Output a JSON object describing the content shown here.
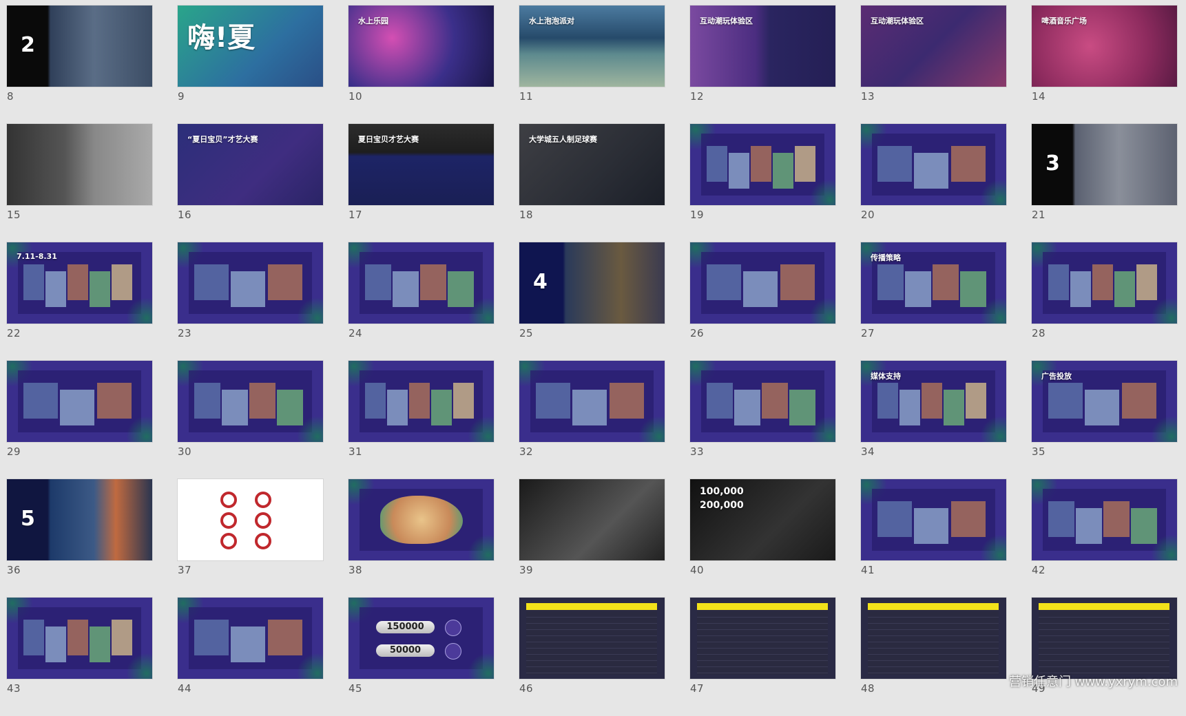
{
  "slides": [
    {
      "num": "8",
      "big": "2",
      "title": "",
      "bg": "linear-gradient(90deg,#0a0a0a 0%,#0a0a0a 28%,#30405a 30%,#5a6d86 60%,#3c4d65 100%)",
      "style": "section"
    },
    {
      "num": "9",
      "big": "嗨!夏",
      "title": "",
      "bg": "linear-gradient(135deg,#2aa58a,#2d6fa0 60%,#2a4f86)",
      "style": "haixia"
    },
    {
      "num": "10",
      "big": "",
      "title": "水上乐园",
      "bg": "radial-gradient(circle at 30% 40%,#d44fb3,#3b2f8a 55%,#1b1748)",
      "style": "party"
    },
    {
      "num": "11",
      "big": "",
      "title": "水上泡泡派对",
      "bg": "linear-gradient(180deg,#4c7ba0 0%,#264a6a 40%,#5d8a8e 60%,#9fb59f 100%)",
      "style": "photo"
    },
    {
      "num": "12",
      "big": "",
      "title": "互动潮玩体验区",
      "bg": "linear-gradient(90deg,#7b4aa0 0%,#4b2d80 45%,#2a2560 55%,#241f55 100%)",
      "style": "photo"
    },
    {
      "num": "13",
      "big": "",
      "title": "互动潮玩体验区",
      "bg": "linear-gradient(135deg,#5b2c73,#3c2a70 50%,#8a3a6a)",
      "style": "photo"
    },
    {
      "num": "14",
      "big": "",
      "title": "啤酒音乐广场",
      "bg": "radial-gradient(circle at 40% 50%,#c94c83,#8d2b5e 60%,#5a1b44)",
      "style": "party"
    },
    {
      "num": "15",
      "big": "",
      "title": "",
      "bg": "linear-gradient(90deg,#333 0%,#555 40%,#888 60%,#aaa 100%)",
      "style": "photo"
    },
    {
      "num": "16",
      "big": "",
      "title": "“夏日宝贝”才艺大赛",
      "bg": "linear-gradient(135deg,#2c2f7a,#3f2d80 60%,#2a2466)",
      "style": "talent"
    },
    {
      "num": "17",
      "big": "",
      "title": "夏日宝贝才艺大赛",
      "bg": "linear-gradient(180deg,#2c2c2c 0%,#1e1e1e 35%,#1d2466 40%,#1a1f55 100%)",
      "style": "dark"
    },
    {
      "num": "18",
      "big": "",
      "title": "大学城五人制足球赛",
      "bg": "linear-gradient(135deg,#3e3f44,#2a2d35 60%,#1b1f28)",
      "style": "dark"
    },
    {
      "num": "19",
      "big": "",
      "title": "",
      "bg": "#3a2e8c",
      "style": "leaf"
    },
    {
      "num": "20",
      "big": "",
      "title": "",
      "bg": "#3a2e8c",
      "style": "leaf"
    },
    {
      "num": "21",
      "big": "3",
      "title": "",
      "bg": "linear-gradient(90deg,#0a0a0a 0%,#0a0a0a 28%,#5a6070 30%,#8a8f9a 60%,#5d6271 100%)",
      "style": "section"
    },
    {
      "num": "22",
      "big": "",
      "title": "7.11-8.31",
      "bg": "#3a2e8c",
      "style": "leaf"
    },
    {
      "num": "23",
      "big": "",
      "title": "",
      "bg": "#3a2e8c",
      "style": "leaf"
    },
    {
      "num": "24",
      "big": "",
      "title": "",
      "bg": "#3a2e8c",
      "style": "leaf"
    },
    {
      "num": "25",
      "big": "4",
      "title": "",
      "bg": "linear-gradient(90deg,#0f1550 0%,#0f1550 30%,#2a3a5a 32%,#6a5a40 70%,#3a3a50 100%)",
      "style": "section"
    },
    {
      "num": "26",
      "big": "",
      "title": "",
      "bg": "#3a2e8c",
      "style": "leaf"
    },
    {
      "num": "27",
      "big": "",
      "title": "传播策略",
      "bg": "#3a2e8c",
      "style": "leaf"
    },
    {
      "num": "28",
      "big": "",
      "title": "",
      "bg": "#3a2e8c",
      "style": "leaf"
    },
    {
      "num": "29",
      "big": "",
      "title": "",
      "bg": "#3a2e8c",
      "style": "leaf"
    },
    {
      "num": "30",
      "big": "",
      "title": "",
      "bg": "#3a2e8c",
      "style": "leaf"
    },
    {
      "num": "31",
      "big": "",
      "title": "",
      "bg": "#3a2e8c",
      "style": "leaf"
    },
    {
      "num": "32",
      "big": "",
      "title": "",
      "bg": "#3a2e8c",
      "style": "leaf"
    },
    {
      "num": "33",
      "big": "",
      "title": "",
      "bg": "#3a2e8c",
      "style": "leaf"
    },
    {
      "num": "34",
      "big": "",
      "title": "媒体支持",
      "bg": "#3a2e8c",
      "style": "leaf"
    },
    {
      "num": "35",
      "big": "",
      "title": "广告投放",
      "bg": "#3a2e8c",
      "style": "leaf"
    },
    {
      "num": "36",
      "big": "5",
      "title": "",
      "bg": "linear-gradient(90deg,#101640 0%,#101640 28%,#1d3a6a 30%,#3c5a86 60%,#c06a40 75%,#2a3550 100%)",
      "style": "section"
    },
    {
      "num": "37",
      "big": "",
      "title": "",
      "bg": "#ffffff",
      "style": "white"
    },
    {
      "num": "38",
      "big": "",
      "title": "",
      "bg": "#3a2e8c",
      "style": "map"
    },
    {
      "num": "39",
      "big": "",
      "title": "",
      "bg": "linear-gradient(135deg,#1a1a1a,#555 60%,#222)",
      "style": "dark"
    },
    {
      "num": "40",
      "big": "",
      "title": "100,000",
      "bg": "linear-gradient(135deg,#111,#333 60%,#1a1a1a)",
      "style": "stats"
    },
    {
      "num": "41",
      "big": "",
      "title": "",
      "bg": "#3a2e8c",
      "style": "leaf"
    },
    {
      "num": "42",
      "big": "",
      "title": "",
      "bg": "#3a2e8c",
      "style": "leaf"
    },
    {
      "num": "43",
      "big": "",
      "title": "",
      "bg": "#3a2e8c",
      "style": "leaf"
    },
    {
      "num": "44",
      "big": "",
      "title": "",
      "bg": "#3a2e8c",
      "style": "leaf"
    },
    {
      "num": "45",
      "big": "",
      "title": "",
      "bg": "#3a2e8c",
      "style": "pills"
    },
    {
      "num": "46",
      "big": "",
      "title": "",
      "bg": "#2a2a45",
      "style": "table"
    },
    {
      "num": "47",
      "big": "",
      "title": "",
      "bg": "#2a2a45",
      "style": "table"
    },
    {
      "num": "48",
      "big": "",
      "title": "",
      "bg": "#2a2a45",
      "style": "table"
    },
    {
      "num": "49",
      "big": "",
      "title": "",
      "bg": "#2a2a45",
      "style": "table"
    }
  ],
  "slide_texts": {
    "s40_line2": "200,000",
    "s45_pill1": "150000",
    "s45_pill2": "50000"
  },
  "watermark": "营销任意门 www.yxrym.com"
}
